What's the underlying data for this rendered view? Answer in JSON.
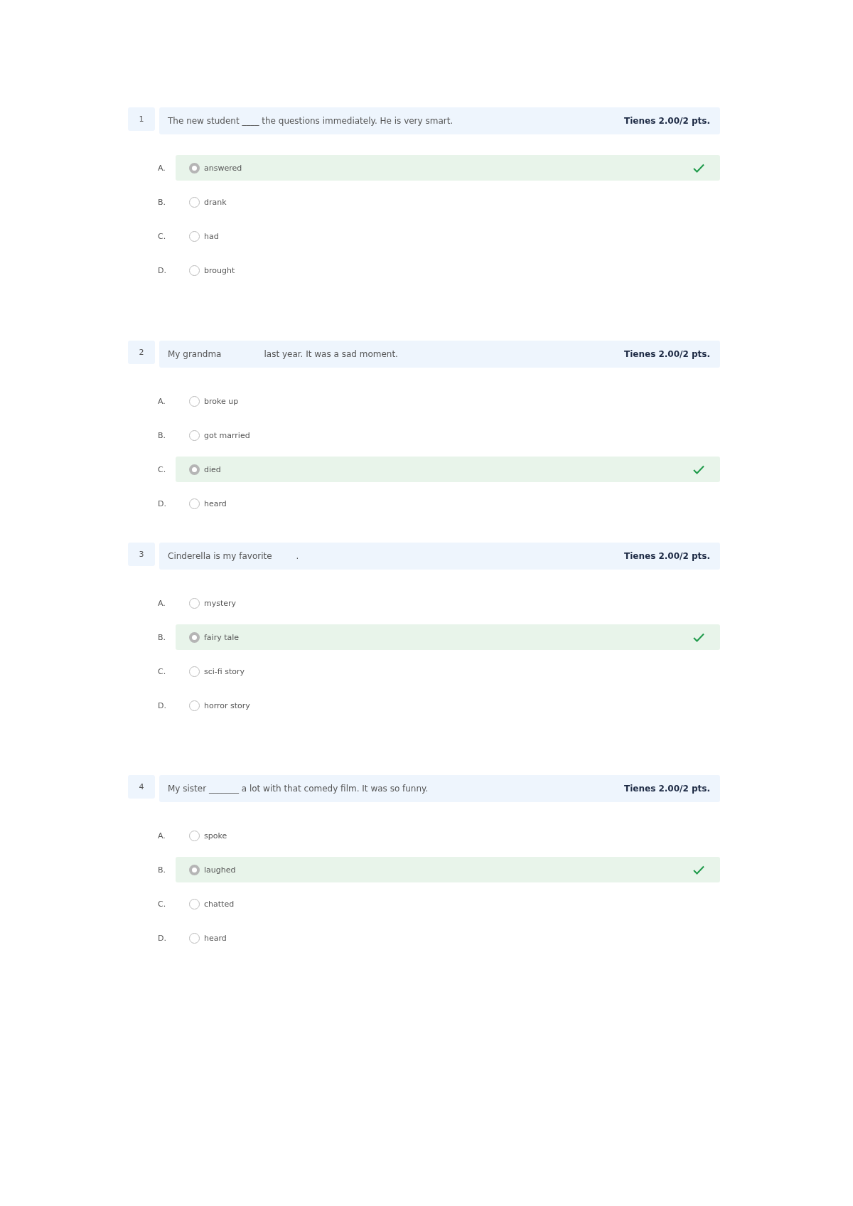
{
  "questions": [
    {
      "number": "1",
      "prompt": [
        "The new student ____ the questions immediately. He is very smart."
      ],
      "score": "Tienes 2.00/2 pts.",
      "options": [
        {
          "letter": "A.",
          "text": "answered",
          "selected": true,
          "correct": true
        },
        {
          "letter": "B.",
          "text": "drank",
          "selected": false,
          "correct": false
        },
        {
          "letter": "C.",
          "text": "had",
          "selected": false,
          "correct": false
        },
        {
          "letter": "D.",
          "text": "brought",
          "selected": false,
          "correct": false
        }
      ]
    },
    {
      "number": "2",
      "prompt": [
        "My grandma",
        "last year. It was a sad moment."
      ],
      "score": "Tienes 2.00/2 pts.",
      "options": [
        {
          "letter": "A.",
          "text": "broke up",
          "selected": false,
          "correct": false
        },
        {
          "letter": "B.",
          "text": "got married",
          "selected": false,
          "correct": false
        },
        {
          "letter": "C.",
          "text": "died",
          "selected": true,
          "correct": true
        },
        {
          "letter": "D.",
          "text": "heard",
          "selected": false,
          "correct": false
        }
      ]
    },
    {
      "number": "3",
      "prompt": [
        "Cinderella is my favorite",
        "."
      ],
      "score": "Tienes 2.00/2 pts.",
      "options": [
        {
          "letter": "A.",
          "text": "mystery",
          "selected": false,
          "correct": false
        },
        {
          "letter": "B.",
          "text": "fairy tale",
          "selected": true,
          "correct": true
        },
        {
          "letter": "C.",
          "text": "sci-fi story",
          "selected": false,
          "correct": false
        },
        {
          "letter": "D.",
          "text": "horror story",
          "selected": false,
          "correct": false
        }
      ]
    },
    {
      "number": "4",
      "prompt": [
        "My sister _______ a lot with that comedy film. It was so funny."
      ],
      "score": "Tienes 2.00/2 pts.",
      "options": [
        {
          "letter": "A.",
          "text": "spoke",
          "selected": false,
          "correct": false
        },
        {
          "letter": "B.",
          "text": "laughed",
          "selected": true,
          "correct": true
        },
        {
          "letter": "C.",
          "text": "chatted",
          "selected": false,
          "correct": false
        },
        {
          "letter": "D.",
          "text": "heard",
          "selected": false,
          "correct": false
        }
      ]
    }
  ]
}
